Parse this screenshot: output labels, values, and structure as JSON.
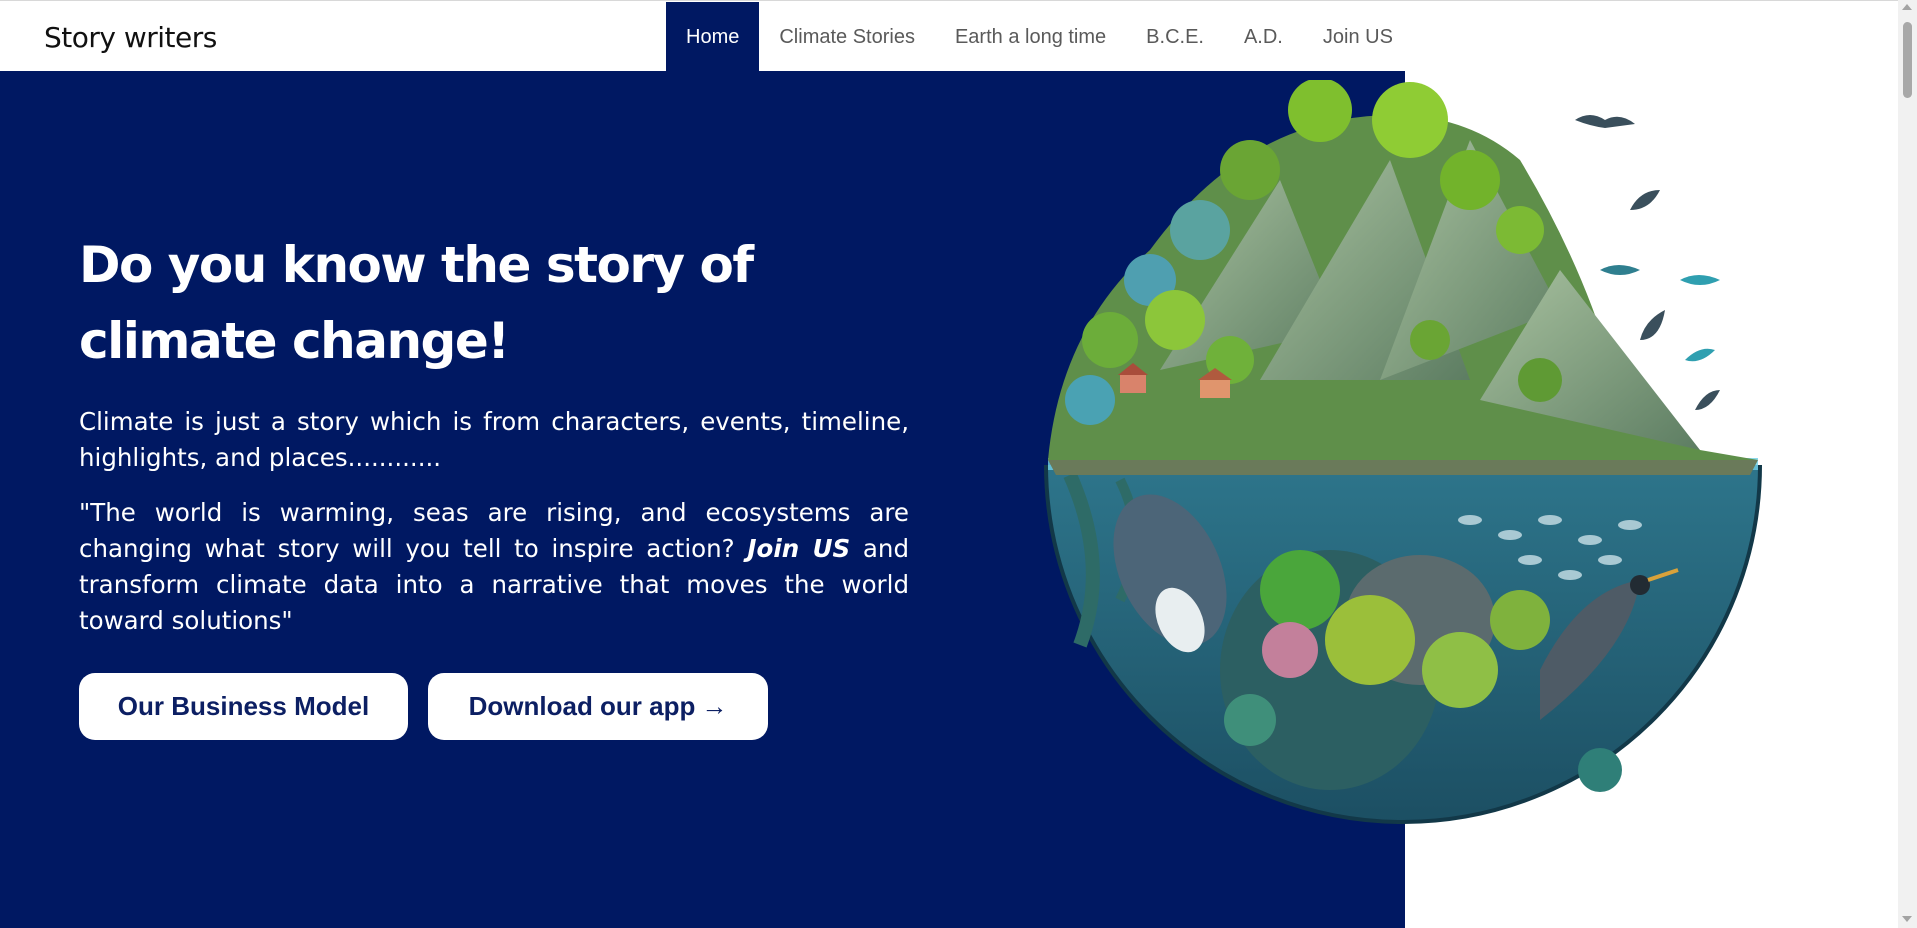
{
  "brand": "Story writers",
  "nav": {
    "items": [
      "Home",
      "Climate Stories",
      "Earth a long time",
      "B.C.E.",
      "A.D.",
      "Join US"
    ],
    "active": "Home"
  },
  "hero": {
    "headline": "Do you know the story of climate change!",
    "para1": "Climate is just a story which is from characters, events, timeline, highlights, and places............",
    "para2_before": "\"The world is warming, seas are rising, and ecosystems are changing what story will you tell to inspire action? ",
    "para2_emph": "Join US",
    "para2_after": " and transform climate data into a narrative that moves the world toward solutions\"",
    "buttons": {
      "business_model": "Our Business Model",
      "download": "Download our app",
      "download_arrow": "→"
    }
  },
  "colors": {
    "hero_bg": "#001862",
    "button_text": "#0c1f63",
    "nav_active_bg": "#001862"
  },
  "image": {
    "subject": "earth-globe-illustration"
  }
}
